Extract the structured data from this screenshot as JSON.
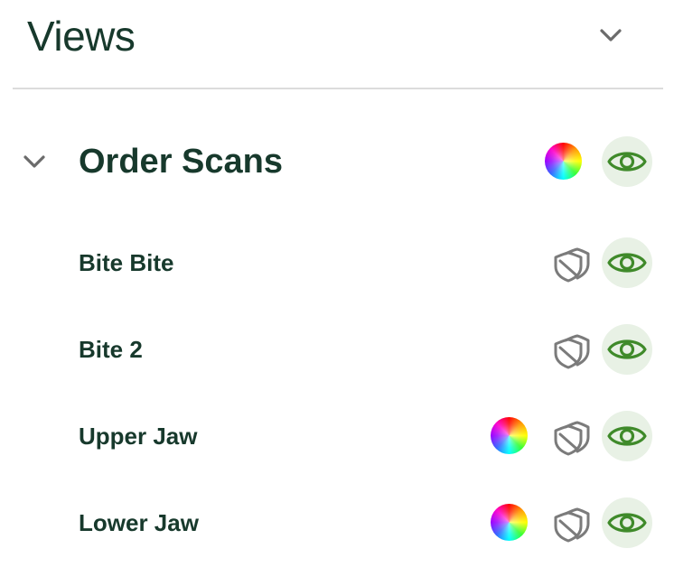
{
  "panel": {
    "title": "Views",
    "title_icon": "chevron-down-icon"
  },
  "group": {
    "title": "Order Scans",
    "expand_icon": "chevron-down-icon",
    "has_color": true,
    "visible": true
  },
  "items": [
    {
      "label": "Bite Bite",
      "has_color": false,
      "has_shield": true,
      "visible": true
    },
    {
      "label": "Bite 2",
      "has_color": false,
      "has_shield": true,
      "visible": true
    },
    {
      "label": "Upper Jaw",
      "has_color": true,
      "has_shield": true,
      "visible": true
    },
    {
      "label": "Lower Jaw",
      "has_color": true,
      "has_shield": true,
      "visible": true
    }
  ],
  "colors": {
    "text": "#17392c",
    "eye_icon": "#3f8a2a",
    "eye_bg": "#e8f1e5",
    "shield_icon": "#7b7b7b",
    "chevron": "#6b6b6b",
    "divider": "#dcdcdc"
  }
}
